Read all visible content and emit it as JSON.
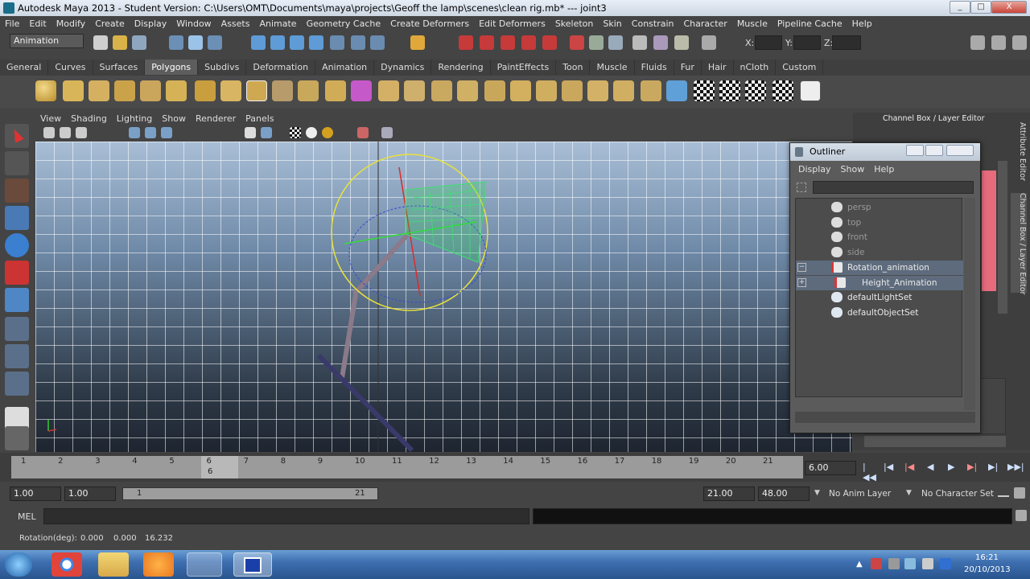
{
  "window": {
    "title": "Autodesk Maya 2013 - Student Version: C:\\Users\\OMT\\Documents\\maya\\projects\\Geoff the lamp\\scenes\\clean rig.mb*   ---   joint3",
    "controls": [
      "_",
      "□",
      "X"
    ]
  },
  "menubar": [
    "File",
    "Edit",
    "Modify",
    "Create",
    "Display",
    "Window",
    "Assets",
    "Animate",
    "Geometry Cache",
    "Create Deformers",
    "Edit Deformers",
    "Skeleton",
    "Skin",
    "Constrain",
    "Character",
    "Muscle",
    "Pipeline Cache",
    "Help"
  ],
  "statusline": {
    "menuset": "Animation",
    "x_label": "X:",
    "y_label": "Y:",
    "z_label": "Z:"
  },
  "shelf_tabs": [
    "General",
    "Curves",
    "Surfaces",
    "Polygons",
    "Subdivs",
    "Deformation",
    "Animation",
    "Dynamics",
    "Rendering",
    "PaintEffects",
    "Toon",
    "Muscle",
    "Fluids",
    "Fur",
    "Hair",
    "nCloth",
    "Custom"
  ],
  "active_shelf": "Polygons",
  "panel_menu": [
    "View",
    "Shading",
    "Lighting",
    "Show",
    "Renderer",
    "Panels"
  ],
  "right_panel": {
    "title": "Channel Box / Layer Editor",
    "side_tabs": [
      "Attribute Editor",
      "Channel Box / Layer Editor"
    ]
  },
  "outliner": {
    "title": "Outliner",
    "menu": [
      "Display",
      "Show",
      "Help"
    ],
    "items": [
      {
        "label": "persp",
        "dim": true,
        "indent": 0,
        "icon": "camera-icon"
      },
      {
        "label": "top",
        "dim": true,
        "indent": 0,
        "icon": "camera-icon"
      },
      {
        "label": "front",
        "dim": true,
        "indent": 0,
        "icon": "camera-icon"
      },
      {
        "label": "side",
        "dim": true,
        "indent": 0,
        "icon": "camera-icon"
      },
      {
        "label": "Rotation_animation",
        "dim": false,
        "indent": 0,
        "icon": "joint-icon",
        "expander": "−",
        "highlight": true
      },
      {
        "label": "Height_Animation",
        "dim": false,
        "indent": 1,
        "icon": "joint-icon",
        "expander": "+",
        "highlight": true
      },
      {
        "label": "defaultLightSet",
        "dim": false,
        "indent": 0,
        "icon": "set-icon"
      },
      {
        "label": "defaultObjectSet",
        "dim": false,
        "indent": 0,
        "icon": "set-icon"
      }
    ]
  },
  "timeslider": {
    "ticks": [
      "1",
      "2",
      "3",
      "4",
      "5",
      "6",
      "7",
      "8",
      "9",
      "10",
      "11",
      "12",
      "13",
      "14",
      "15",
      "16",
      "17",
      "18",
      "19",
      "20",
      "21"
    ],
    "current_frame_marker": "6",
    "current_time": "6.00"
  },
  "rangeslider": {
    "start_time": "1.00",
    "range_start": "1.00",
    "bar_start": "1",
    "bar_end": "21",
    "range_end": "21.00",
    "end_time": "48.00",
    "anim_layer": "No Anim Layer",
    "character_set": "No Character Set"
  },
  "cmdline": {
    "label": "MEL"
  },
  "helpline": {
    "label": "Rotation(deg):",
    "values": [
      "0.000",
      "0.000",
      "16.232"
    ]
  },
  "taskbar": {
    "time": "16:21",
    "date": "20/10/2013"
  }
}
